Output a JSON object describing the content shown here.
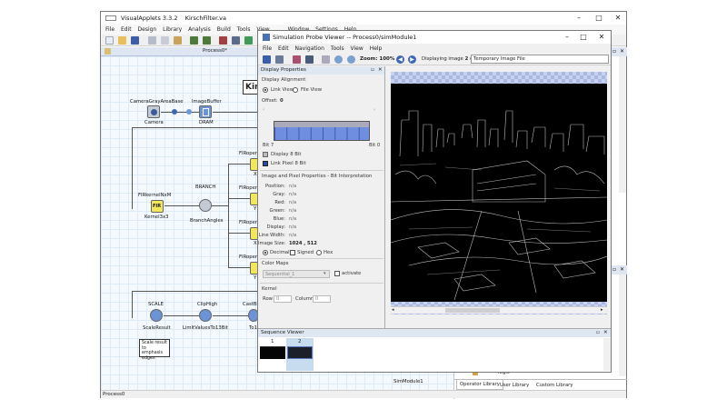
{
  "main_window": {
    "title": "VisualApplets 3.3.2",
    "filename": "KirschFilter.va",
    "menu": [
      "File",
      "Edit",
      "Design",
      "Library",
      "Analysis",
      "Build",
      "Tools",
      "View",
      "Window",
      "Settings",
      "Help"
    ],
    "process_tab": "Process0*",
    "status": "Process0",
    "kirsch_label": "Kirs",
    "nodes": {
      "camera_type": "CameraGrayAreaBase",
      "camera_name": "Camera",
      "imagebuffer_type": "ImageBuffer",
      "imagebuffer_name": "DRAM",
      "firkernel_type": "FIRkernelNxM",
      "firkernel_name": "Kernel3x3",
      "firkernel_glyph": "FIR",
      "branch_type": "BRANCH",
      "branch_name": "BranchAngles",
      "firoper_1": "FIRoper",
      "firoper_2": "FIRoper",
      "firoper_3": "FIRoper",
      "firoper_4": "FIRoper",
      "firoper_sub_1": "X",
      "firoper_sub_2": "Y",
      "firoper_sub_3": "X",
      "firoper_sub_4": "Y",
      "scale_type": "SCALE",
      "scale_name": "ScaleResult",
      "cliphigh_type": "ClipHigh",
      "cliphigh_name": "LimitValuesTo13Bit",
      "cast_type": "CastBi",
      "cast_name": "To1",
      "simmodule": "SimModule1"
    },
    "comment": "Scale result to emphasis edges",
    "right_panel": {
      "tree_item": "logic",
      "tabs": [
        "Operator Library",
        "User Library",
        "Custom Library"
      ]
    }
  },
  "probe_window": {
    "title": "Simulation Probe Viewer -- Process0/simModule1",
    "menu": [
      "File",
      "Edit",
      "Navigation",
      "Tools",
      "View",
      "Help"
    ],
    "zoom": "Zoom: 100%",
    "displaying_prefix": "Displaying image",
    "current_image": "2",
    "of_text": "of",
    "total_images": "2",
    "image_name": "Temporary Image File",
    "display_properties": {
      "header": "Display Properties",
      "alignment_header": "Display Alignment",
      "link_view": "Link View",
      "file_view": "File View",
      "offset_label": "Offset:",
      "offset_value": "0",
      "bit_left": "Bit 7",
      "bit_right": "Bit 0",
      "legend_1": "Display 8 Bit",
      "legend_2": "Link Pixel 8 Bit"
    },
    "pixel_props": {
      "header": "Image and Pixel Properties - Bit Interpretation",
      "rows": [
        {
          "label": "Position:",
          "value": "n/a"
        },
        {
          "label": "Gray:",
          "value": "n/a"
        },
        {
          "label": "Red:",
          "value": "n/a"
        },
        {
          "label": "Green:",
          "value": "n/a"
        },
        {
          "label": "Blue:",
          "value": "n/a"
        },
        {
          "label": "Display:",
          "value": "n/a"
        },
        {
          "label": "Line Width:",
          "value": "n/a"
        }
      ],
      "image_size_label": "Image Size:",
      "image_size_value": "1024 , 512",
      "decimal": "Decimal",
      "signed": "Signed",
      "hex": "Hex"
    },
    "color_maps": {
      "header": "Color Maps",
      "selected": "Sequential_1",
      "activate": "activate"
    },
    "kernel": {
      "header": "Kernel",
      "row_label": "Row",
      "row_value": "0",
      "column_label": "Column",
      "column_value": "0"
    },
    "sequence_viewer": {
      "header": "Sequence Viewer",
      "frames": [
        "1",
        "2"
      ]
    }
  },
  "colors": {
    "accent_blue": "#3f68b4",
    "bit_bar": "#6f8ee0",
    "canvas_grid": "#dcebf7",
    "node_yellow": "#f2e65a",
    "node_blue": "#6c93d6"
  }
}
